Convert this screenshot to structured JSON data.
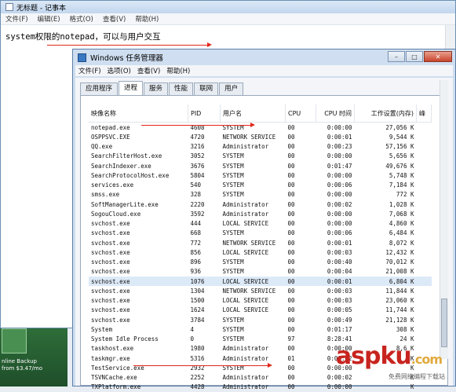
{
  "desktop": {
    "label": "nline Backup\nfrom $3.47/mo"
  },
  "notepad": {
    "title": "无标题 - 记事本",
    "menu": [
      "文件(F)",
      "编辑(E)",
      "格式(O)",
      "查看(V)",
      "帮助(H)"
    ],
    "content": "system权限的notepad，可以与用户交互"
  },
  "taskmgr": {
    "title": "Windows 任务管理器",
    "menu": [
      "文件(F)",
      "选项(O)",
      "查看(V)",
      "帮助(H)"
    ],
    "tabs": [
      "应用程序",
      "进程",
      "服务",
      "性能",
      "联网",
      "用户"
    ],
    "active_tab": 1,
    "columns": [
      "映像名称",
      "PID",
      "用户名",
      "CPU",
      "CPU 时间",
      "工作设置(内存)",
      "峰"
    ],
    "rows": [
      [
        "notepad.exe",
        "4608",
        "SYSTEM",
        "00",
        "0:00:00",
        "27,056 K"
      ],
      [
        "OSPPSVC.EXE",
        "4720",
        "NETWORK SERVICE",
        "00",
        "0:00:01",
        "9,544 K"
      ],
      [
        "QQ.exe",
        "3216",
        "Administrator",
        "00",
        "0:00:23",
        "57,156 K"
      ],
      [
        "SearchFilterHost.exe",
        "3052",
        "SYSTEM",
        "00",
        "0:00:00",
        "5,656 K"
      ],
      [
        "SearchIndexer.exe",
        "3676",
        "SYSTEM",
        "00",
        "0:01:47",
        "49,676 K"
      ],
      [
        "SearchProtocolHost.exe",
        "5804",
        "SYSTEM",
        "00",
        "0:00:00",
        "5,748 K"
      ],
      [
        "services.exe",
        "540",
        "SYSTEM",
        "00",
        "0:00:06",
        "7,184 K"
      ],
      [
        "smss.exe",
        "328",
        "SYSTEM",
        "00",
        "0:00:00",
        "772 K"
      ],
      [
        "SoftManagerLite.exe",
        "2220",
        "Administrator",
        "00",
        "0:00:02",
        "1,028 K"
      ],
      [
        "SogouCloud.exe",
        "3592",
        "Administrator",
        "00",
        "0:00:00",
        "7,068 K"
      ],
      [
        "svchost.exe",
        "444",
        "LOCAL SERVICE",
        "00",
        "0:00:00",
        "4,860 K"
      ],
      [
        "svchost.exe",
        "668",
        "SYSTEM",
        "00",
        "0:00:06",
        "6,484 K"
      ],
      [
        "svchost.exe",
        "772",
        "NETWORK SERVICE",
        "00",
        "0:00:01",
        "8,072 K"
      ],
      [
        "svchost.exe",
        "856",
        "LOCAL SERVICE",
        "00",
        "0:00:03",
        "12,432 K"
      ],
      [
        "svchost.exe",
        "896",
        "SYSTEM",
        "00",
        "0:00:40",
        "70,012 K"
      ],
      [
        "svchost.exe",
        "936",
        "SYSTEM",
        "00",
        "0:00:04",
        "21,008 K"
      ],
      [
        "svchost.exe",
        "1076",
        "LOCAL SERVICE",
        "00",
        "0:00:01",
        "6,804 K"
      ],
      [
        "svchost.exe",
        "1304",
        "NETWORK SERVICE",
        "00",
        "0:00:03",
        "11,844 K"
      ],
      [
        "svchost.exe",
        "1500",
        "LOCAL SERVICE",
        "00",
        "0:00:03",
        "23,060 K"
      ],
      [
        "svchost.exe",
        "1624",
        "LOCAL SERVICE",
        "00",
        "0:00:05",
        "11,744 K"
      ],
      [
        "svchost.exe",
        "3784",
        "SYSTEM",
        "00",
        "0:00:49",
        "21,128 K"
      ],
      [
        "System",
        "4",
        "SYSTEM",
        "00",
        "0:01:17",
        "308 K"
      ],
      [
        "System Idle Process",
        "0",
        "SYSTEM",
        "97",
        "8:28:41",
        "24 K"
      ],
      [
        "taskhost.exe",
        "1980",
        "Administrator",
        "00",
        "0:00:00",
        "8,6 K"
      ],
      [
        "taskmgr.exe",
        "5316",
        "Administrator",
        "01",
        "0:00:02",
        "K"
      ],
      [
        "TestService.exe",
        "2932",
        "SYSTEM",
        "00",
        "0:00:00",
        "K"
      ],
      [
        "TSVNCache.exe",
        "2252",
        "Administrator",
        "00",
        "0:00:02",
        "K"
      ],
      [
        "TXPlatform.exe",
        "4428",
        "Administrator",
        "00",
        "0:00:00",
        "K"
      ]
    ],
    "selected_row": 16
  },
  "watermark": {
    "main": "asp",
    "accent": "ku",
    "tld": ".com",
    "sub": "免费网络编程下载站"
  },
  "colors": {
    "arrow": "#e0281b",
    "selection": "#dce9f7"
  }
}
